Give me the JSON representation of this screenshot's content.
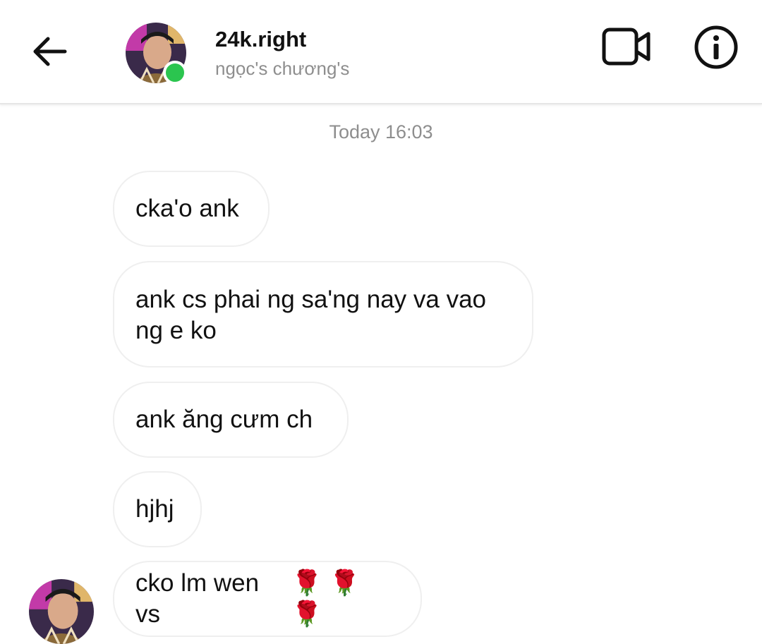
{
  "header": {
    "username": "24k.right",
    "subtitle": "ngọc's chương's",
    "back_icon": "arrow-left-icon",
    "video_icon": "video-camera-icon",
    "info_icon": "info-icon"
  },
  "conversation": {
    "timestamp": "Today 16:03",
    "messages": [
      {
        "text": "cka'o ank"
      },
      {
        "text": "ank cs phai ng sa'ng nay va vao ng e ko"
      },
      {
        "text": "ank ăng cưm ch"
      },
      {
        "text": "hjhj"
      },
      {
        "text": "cko lm wen vs",
        "emoji": "🌹🌹🌹"
      }
    ]
  },
  "colors": {
    "online": "#2bc54f",
    "secondary_text": "#8e8e8e",
    "bubble_border": "#efefef"
  }
}
